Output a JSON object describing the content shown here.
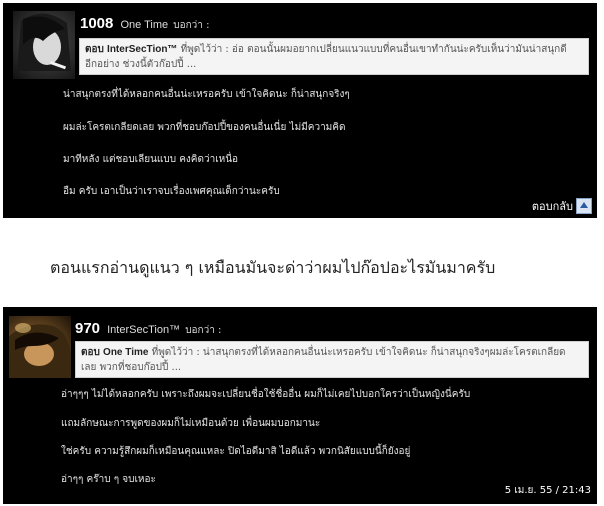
{
  "post1": {
    "number": "1008",
    "username": "One Time",
    "said": "บอกว่า :",
    "quote_prefix": "ตอบ",
    "quote_user": "InterSecTion™",
    "quote_said": "ที่พูดไว้ว่า :",
    "quote_text_line1": "อ่อ ตอนนั้นผมอยากเปลี่ยนแนวแบบที่คนอื่นเขาทำกันน่ะครับเห็นว่ามันน่าสนุกดี",
    "quote_text_line2": "อีกอย่าง ช่วงนี้ตัวก๊อปปี้ ...",
    "lines": [
      "น่าสนุกตรงที่ได้หลอกคนอื่นน่ะเหรอครับ เข้าใจคิดนะ ก็น่าสนุกจริงๆ",
      "ผมล่ะโครตเกลียดเลย พวกที่ชอบก๊อปปี้ของคนอื่นเนี่ย ไม่มีความคิด",
      "มาทีหลัง แต่ชอบเลียนแบบ คงคิดว่าเหนื่อ",
      "อืม ครับ เอาเป็นว่าเราจบเรื่องเพศคุณเด็กว่านะครับ"
    ],
    "reply_label": "ตอบกลับ"
  },
  "caption": "ตอนแรกอ่านดูแนว ๆ เหมือนมันจะด่าว่าผมไปก๊อปอะไรมันมาครับ",
  "post2": {
    "number": "970",
    "username": "InterSecTion™",
    "said": "บอกว่า :",
    "quote_prefix": "ตอบ",
    "quote_user": "One Time",
    "quote_said": "ที่พูดไว้ว่า :",
    "quote_text_line1": "น่าสนุกตรงที่ได้หลอกคนอื่นน่ะเหรอครับ เข้าใจคิดนะ ก็น่าสนุกจริงๆผมล่ะโครตเกลียด",
    "quote_text_line2": "เลย พวกที่ชอบก๊อปปี้ ...",
    "lines": [
      "อ่าๆๆๆ ไม่ได้หลอกครับ เพราะถึงผมจะเปลี่ยนชื่อใช้ชื่ออื่น ผมก็ไม่เคยไปบอกใครว่าเป็นหญิงนี่ครับ",
      "แถมลักษณะการพูดของผมก็ไม่เหมือนด้วย เพื่อนผมบอกมานะ",
      "ใช่ครับ ความรู้สึกผมก็เหมือนคุณแหละ ปิดไอดีมาสิ ไอดีแล้ว พวกนิสัยแบบนี้ก็ยังอยู่",
      "อ่าๆๆ คร๊าบ ๆ จบเหอะ"
    ],
    "timestamp": "5 เม.ย. 55 / 21:43"
  }
}
